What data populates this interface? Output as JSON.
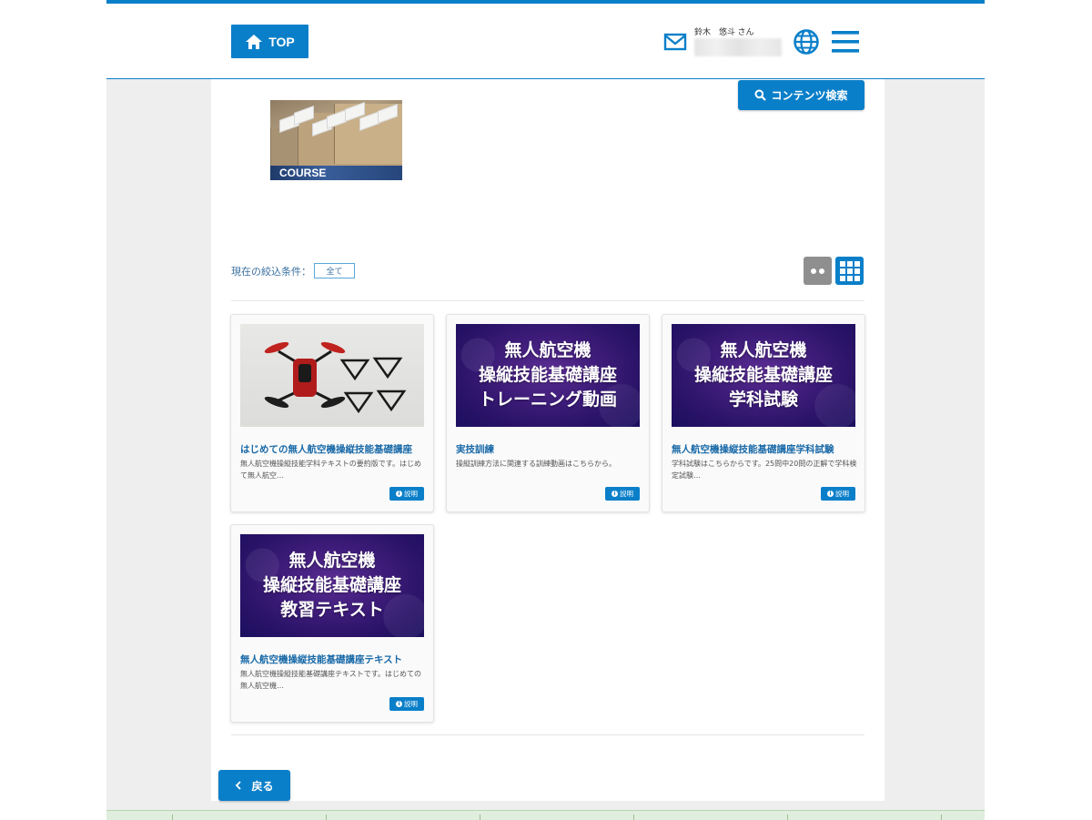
{
  "header": {
    "top_label": "TOP",
    "user_name": "鈴木　悠斗 さん"
  },
  "toolbar": {
    "search_label": "コンテンツ検索"
  },
  "course_banner": {
    "label": "COURSE"
  },
  "filter": {
    "label": "現在の絞込条件：",
    "chip": "全て"
  },
  "cards": [
    {
      "title": "はじめての無人航空機操縦技能基礎講座",
      "description": "無人航空機操縦技能学科テキストの要約版です。はじめて無人航空…",
      "info_label": "説明",
      "thumb_lines": []
    },
    {
      "title": "実技訓練",
      "description": "操縦訓練方法に関連する訓練動画はこちらから。",
      "info_label": "説明",
      "thumb_lines": [
        "無人航空機",
        "操縦技能基礎講座",
        "トレーニング動画"
      ]
    },
    {
      "title": "無人航空機操縦技能基礎講座学科試験",
      "description": "学科試験はこちらからです。25問中20問の正解で学科検定試験…",
      "info_label": "説明",
      "thumb_lines": [
        "無人航空機",
        "操縦技能基礎講座",
        "学科試験"
      ]
    },
    {
      "title": "無人航空機操縦技能基礎講座テキスト",
      "description": "無人航空機操縦技能基礎講座テキストです。はじめての無人航空機…",
      "info_label": "説明",
      "thumb_lines": [
        "無人航空機",
        "操縦技能基礎講座",
        "教習テキスト"
      ]
    }
  ],
  "back_label": "戻る",
  "colors": {
    "accent": "#0a7fc9",
    "title_link": "#1a6aa8"
  }
}
